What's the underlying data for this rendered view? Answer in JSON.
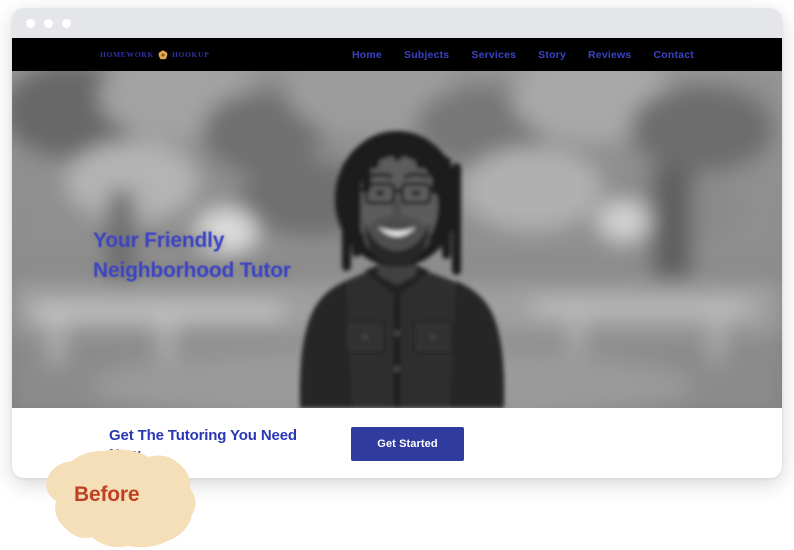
{
  "window": {
    "titlebar_dots": [
      "close-dot",
      "minimize-dot",
      "maximize-dot"
    ]
  },
  "site": {
    "brand": {
      "word_left": "HOMEWORK",
      "word_right": "HOOKUP",
      "mark_icon": "flower-emblem-icon",
      "text_color": "#2f31a0",
      "mark_color": "#d99a44"
    },
    "nav": {
      "items": [
        {
          "label": "Home"
        },
        {
          "label": "Subjects"
        },
        {
          "label": "Services"
        },
        {
          "label": "Story"
        },
        {
          "label": "Reviews"
        },
        {
          "label": "Contact"
        }
      ],
      "background": "#000000",
      "link_color": "#3b43c4"
    },
    "hero": {
      "heading": "Your Friendly Neighborhood Tutor",
      "heading_color": "#3b43c4",
      "photo_alt": "smiling-tutor-portrait",
      "photo_filter": "grayscale"
    },
    "cta": {
      "heading": "Get The Tutoring You Need Now",
      "heading_color": "#2b38b5",
      "button_label": "Get Started",
      "button_color": "#303c9d",
      "button_text_color": "#ffffff"
    }
  },
  "annotation": {
    "label": "Before",
    "label_color": "#bf4123",
    "blob_color": "#f5dfb9"
  }
}
